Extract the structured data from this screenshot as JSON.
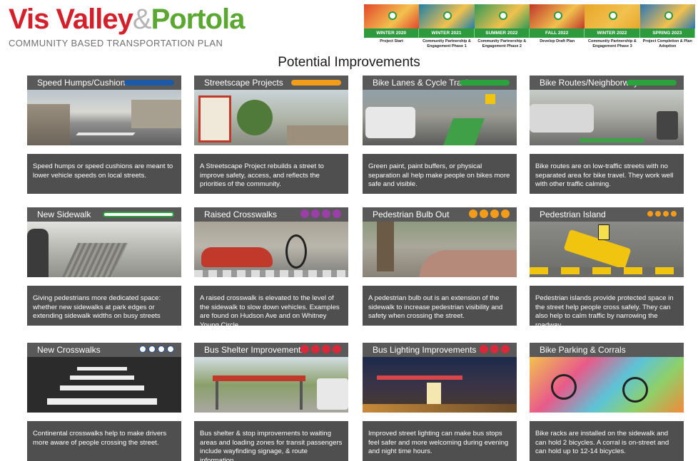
{
  "header": {
    "logo_part1": "Vis Valley",
    "logo_amp": "&",
    "logo_part2": "Portola",
    "subtitle": "COMMUNITY BASED TRANSPORTATION PLAN",
    "main_title": "Potential Improvements"
  },
  "timeline": {
    "phases": [
      {
        "date": "WINTER 2020",
        "label": "Project Start"
      },
      {
        "date": "WINTER 2021",
        "label": "Community Partnership & Engagement Phase 1"
      },
      {
        "date": "SUMMER 2022",
        "label": "Community Partnership & Engagement Phase 2"
      },
      {
        "date": "FALL 2022",
        "label": "Develop Draft Plan"
      },
      {
        "date": "WINTER 2022",
        "label": "Community Partnership & Engagement Phase 3"
      },
      {
        "date": "SPRING 2023",
        "label": "Project Completion & Plan Adoption"
      }
    ],
    "band_colors": [
      "#e2472c",
      "#1d7fa8",
      "#2f9a56",
      "#c0382b",
      "#e7a72a",
      "#2b76b6"
    ]
  },
  "cards": [
    {
      "title": "Speed Humps/Cushions",
      "description": "Speed humps or speed cushions are meant to lower vehicle speeds on local streets.",
      "indicator": {
        "type": "bar",
        "color": "#1c5aa8"
      }
    },
    {
      "title": "Streetscape Projects",
      "description": "A Streetscape Project rebuilds a street to improve safety, access, and reflects the priorities of the community.",
      "indicator": {
        "type": "bar",
        "color": "#f39c1a"
      }
    },
    {
      "title": "Bike Lanes & Cycle Tracks",
      "description": "Green paint, paint buffers, or physical separation all help make people on bikes more safe and visible.",
      "indicator": {
        "type": "bar",
        "color": "#2aa33c"
      }
    },
    {
      "title": "Bike Routes/Neighborways",
      "description": "Bike routes are on low-traffic streets with no separated area for bike travel. They work well with other traffic calming.",
      "indicator": {
        "type": "bar",
        "color": "#2aa33c"
      }
    },
    {
      "title": "New Sidewalk",
      "description": "Giving pedestrians more dedicated space: whether new sidewalks at park edges or extending sidewalk widths on busy streets",
      "indicator": {
        "type": "outlined-bar",
        "color": "#2aa33c"
      }
    },
    {
      "title": "Raised Crosswalks",
      "description": "A raised crosswalk is elevated to the level of the sidewalk to slow down vehicles. Examples are found on Hudson Ave and on Whitney Young Circle.",
      "indicator": {
        "type": "dots",
        "color": "#9b3fa8",
        "count": 4
      }
    },
    {
      "title": "Pedestrian Bulb Out",
      "description": "A pedestrian bulb out is an extension of the sidewalk to increase pedestrian visibility and safety when crossing the street.",
      "indicator": {
        "type": "dots",
        "color": "#f39c1a",
        "count": 4
      }
    },
    {
      "title": "Pedestrian Island",
      "description": "Pedestrian islands provide protected space in the street help people cross safely. They can also help to calm traffic by narrowing the roadway.",
      "indicator": {
        "type": "small-dots",
        "color": "#f39c1a",
        "count": 4
      }
    },
    {
      "title": "New Crosswalks",
      "description": "Continental crosswalks help to make drivers more aware of people crossing the street.",
      "indicator": {
        "type": "ring-dots",
        "color": "#1c5aa8",
        "count": 4
      }
    },
    {
      "title": "Bus Shelter Improvements",
      "description": "Bus shelter & stop improvements to waiting areas and loading zones for transit passengers include wayfinding signage, & route information.",
      "indicator": {
        "type": "dots",
        "color": "#d8283a",
        "count": 4
      }
    },
    {
      "title": "Bus Lighting Improvements",
      "description": "Improved street lighting can make bus stops feel safer and more welcoming during evening and night time hours.",
      "indicator": {
        "type": "dots",
        "color": "#d8283a",
        "count": 3
      }
    },
    {
      "title": "Bike Parking & Corrals",
      "description": "Bike racks are installed on the sidewalk and can hold 2 bicycles. A corral is on-street and can hold up to 12-14 bicycles.",
      "indicator": {
        "type": "none",
        "color": ""
      }
    }
  ]
}
